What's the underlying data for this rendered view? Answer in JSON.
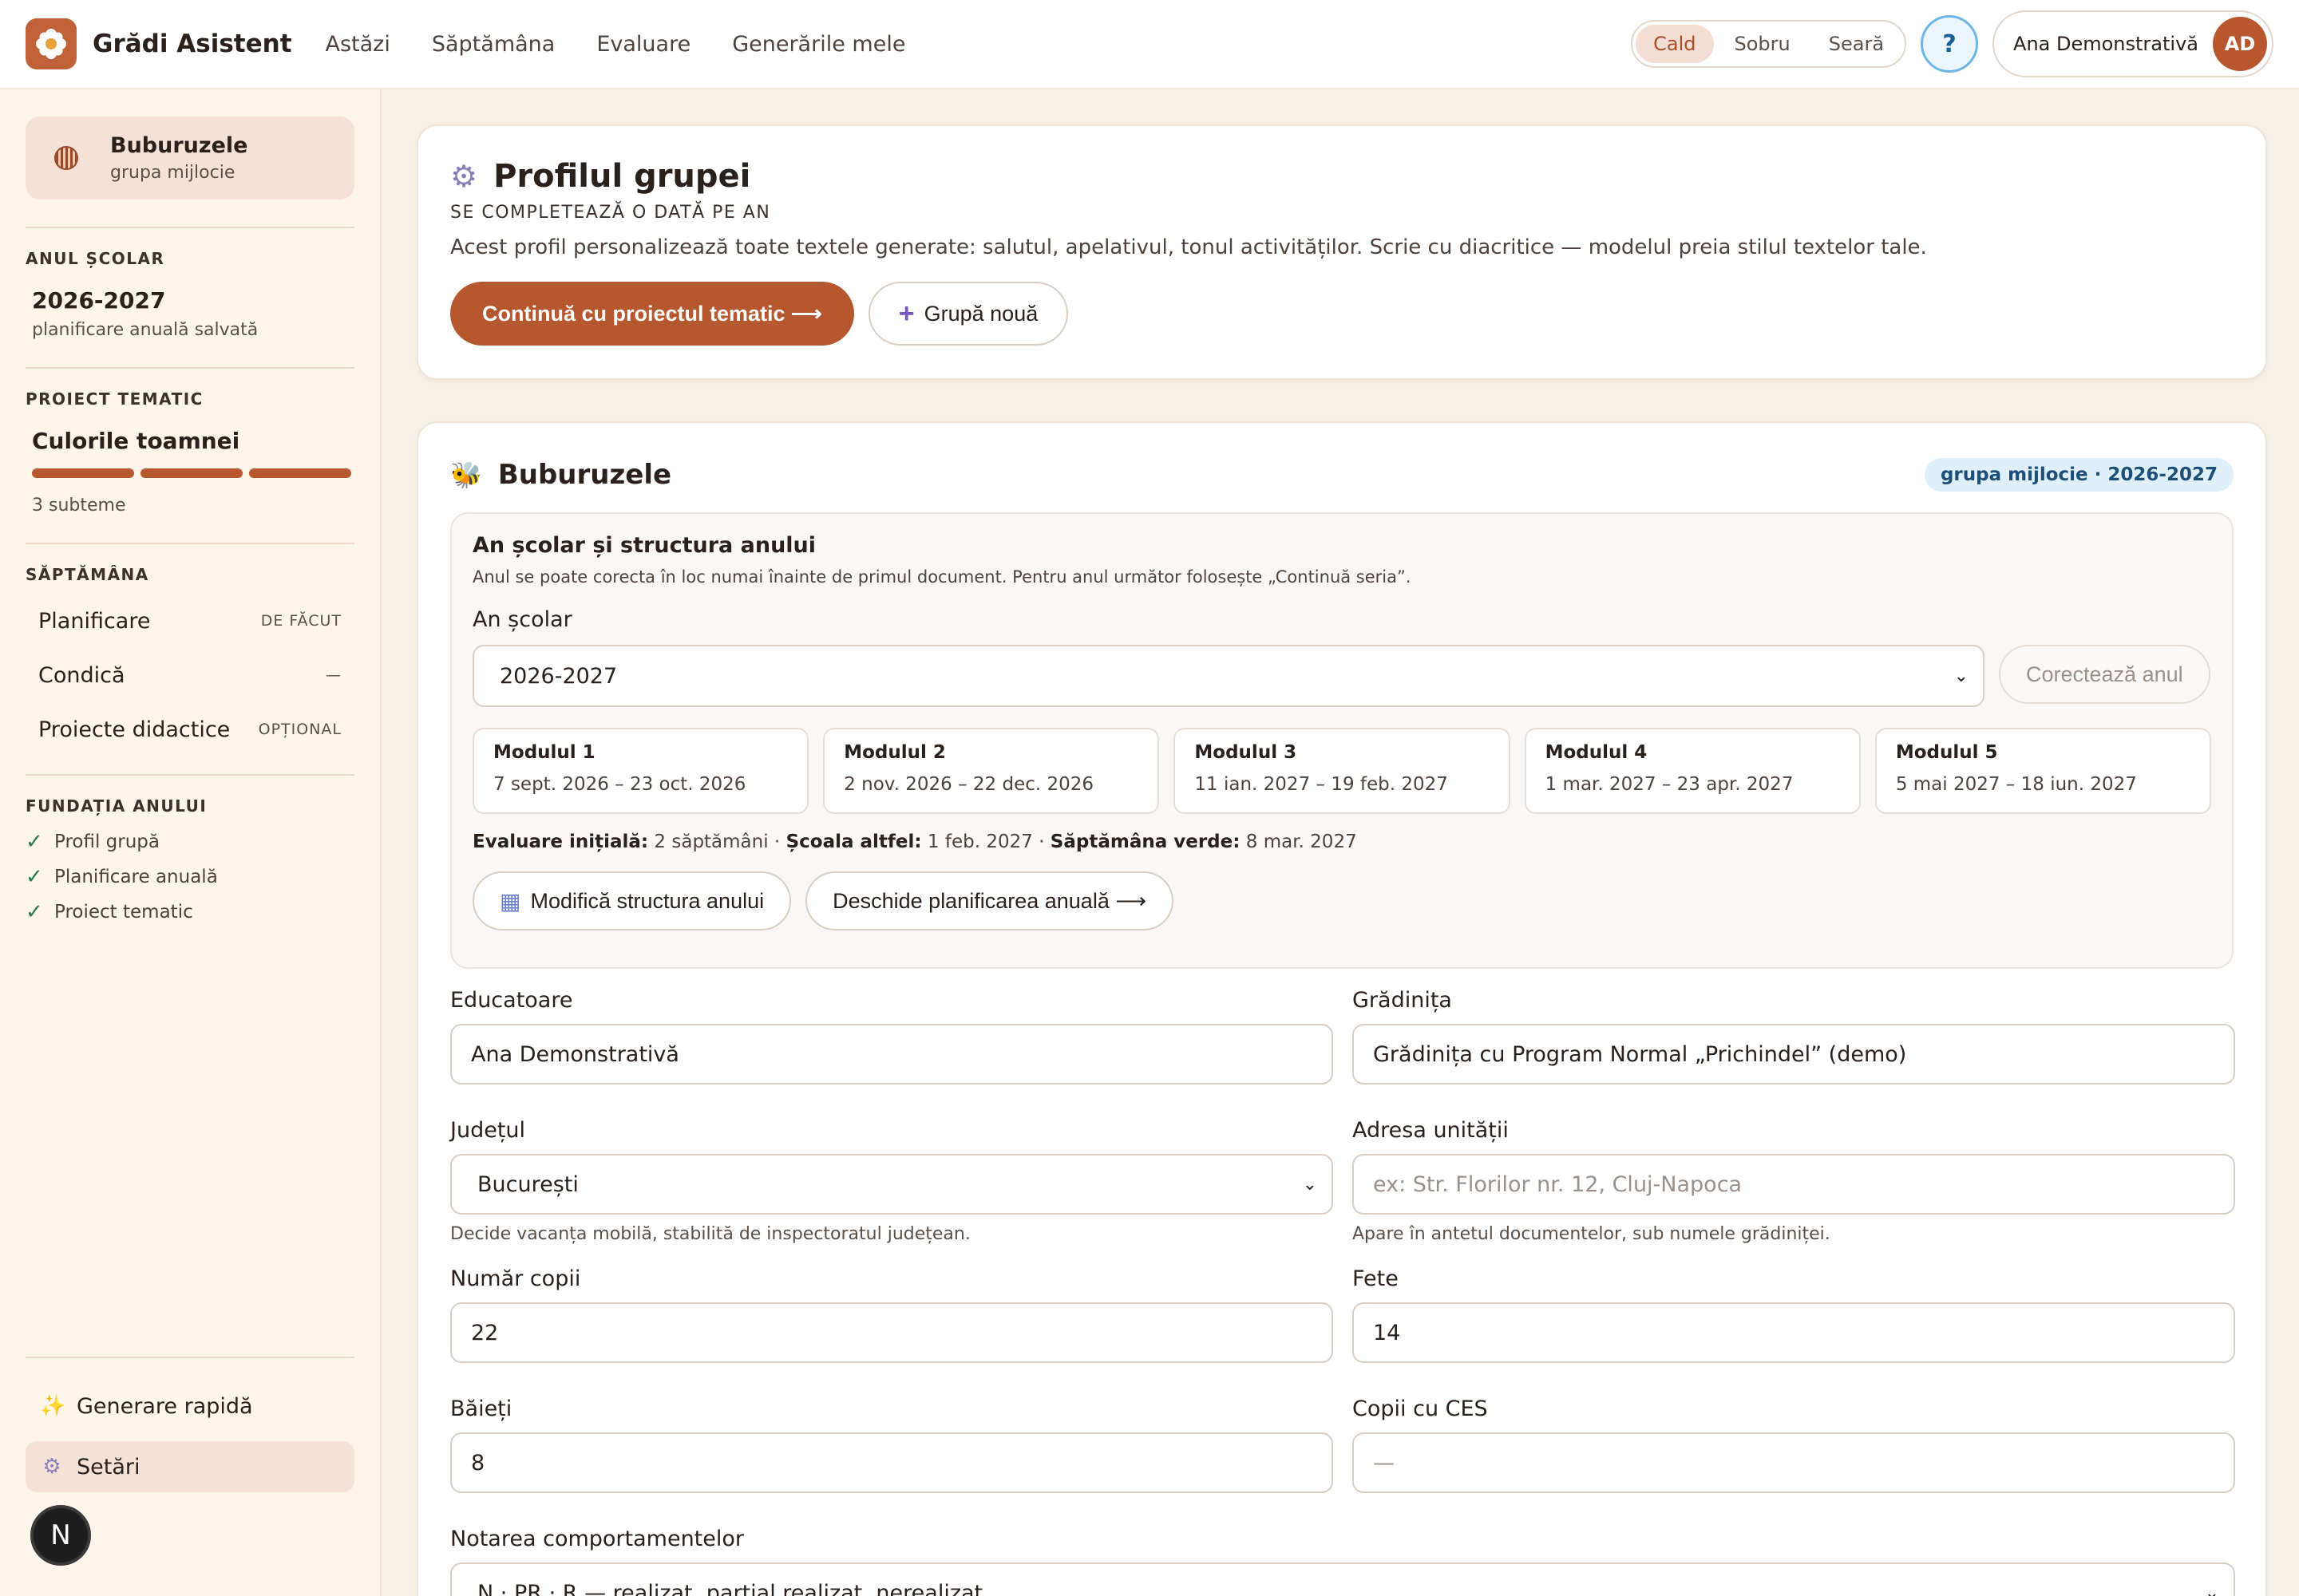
{
  "topbar": {
    "brand": "Grădi Asistent",
    "nav": [
      "Astăzi",
      "Săptămâna",
      "Evaluare",
      "Generările mele"
    ],
    "modes": [
      "Cald",
      "Sobru",
      "Seară"
    ],
    "active_mode": "Cald",
    "help": "?",
    "user_name": "Ana Demonstrativă",
    "user_initials": "AD"
  },
  "sidebar": {
    "group_name": "Buburuzele",
    "group_sub": "grupa mijlocie",
    "year_label": "ANUL ȘCOLAR",
    "year_value": "2026-2027",
    "year_sub": "planificare anuală salvată",
    "project_label": "PROIECT TEMATIC",
    "project_value": "Culorile toamnei",
    "project_sub": "3 subteme",
    "project_progress": [
      1,
      1,
      1
    ],
    "week_label": "SĂPTĂMÂNA",
    "week_items": [
      {
        "label": "Planificare",
        "status": "DE FĂCUT"
      },
      {
        "label": "Condică",
        "status": "—"
      },
      {
        "label": "Proiecte didactice",
        "status": "OPȚIONAL"
      }
    ],
    "foundation_label": "FUNDAȚIA ANULUI",
    "foundation_items": [
      "Profil grupă",
      "Planificare anuală",
      "Proiect tematic"
    ],
    "bottom_links": [
      {
        "label": "Generare rapidă",
        "icon": "sparkles-icon"
      },
      {
        "label": "Setări",
        "icon": "gear-icon"
      }
    ],
    "n_badge": "N"
  },
  "profile_card": {
    "title": "Profilul grupei",
    "eyebrow": "SE COMPLETEAZĂ O DATĂ PE AN",
    "description": "Acest profil personalizează toate textele generate: salutul, apelativul, tonul activităților. Scrie cu diacritice — modelul preia stilul textelor tale.",
    "primary_button": "Continuă cu proiectul tematic ⟶",
    "secondary_button": "Grupă nouă"
  },
  "group_card": {
    "title": "Buburuzele",
    "pill": "grupa mijlocie · 2026-2027",
    "year_panel": {
      "title": "An școlar și structura anului",
      "subtitle": "Anul se poate corecta în loc numai înainte de primul document. Pentru anul următor folosește „Continuă seria”.",
      "label": "An școlar",
      "selected_year": "2026-2027",
      "correct_button": "Corectează anul",
      "modules": [
        {
          "name": "Modulul 1",
          "dates": "7 sept. 2026 – 23 oct. 2026"
        },
        {
          "name": "Modulul 2",
          "dates": "2 nov. 2026 – 22 dec. 2026"
        },
        {
          "name": "Modulul 3",
          "dates": "11 ian. 2027 – 19 feb. 2027"
        },
        {
          "name": "Modulul 4",
          "dates": "1 mar. 2027 – 23 apr. 2027"
        },
        {
          "name": "Modulul 5",
          "dates": "5 mai 2027 – 18 iun. 2027"
        }
      ],
      "meta": [
        {
          "label": "Evaluare inițială:",
          "value": " 2 săptămâni · "
        },
        {
          "label": "Școala altfel:",
          "value": " 1 feb. 2027 · "
        },
        {
          "label": "Săptămâna verde:",
          "value": " 8 mar. 2027"
        }
      ],
      "modify_button": "Modifică structura anului",
      "open_button": "Deschide planificarea anuală ⟶"
    },
    "fields": {
      "educatoare_label": "Educatoare",
      "educatoare_value": "Ana Demonstrativă",
      "gradinita_label": "Grădinița",
      "gradinita_value": "Grădinița cu Program Normal „Prichindel” (demo)",
      "judet_label": "Județul",
      "judet_value": "București",
      "judet_hint": "Decide vacanța mobilă, stabilită de inspectoratul județean.",
      "adresa_label": "Adresa unității",
      "adresa_placeholder": "ex: Str. Florilor nr. 12, Cluj-Napoca",
      "adresa_hint": "Apare în antetul documentelor, sub numele grădiniței.",
      "copii_label": "Număr copii",
      "copii_value": "22",
      "fete_label": "Fete",
      "fete_value": "14",
      "baieti_label": "Băieți",
      "baieti_value": "8",
      "ces_label": "Copii cu CES",
      "ces_placeholder": "—",
      "notare_label": "Notarea comportamentelor",
      "notare_value": "N · PR · R — realizat, parțial realizat, nerealizat"
    }
  },
  "colors": {
    "accent": "#b5582f",
    "page_bg": "#f6f0e8",
    "sidebar_bg": "#fdf4ea",
    "pill_bg": "#dff0fb",
    "check_green": "#2c7a4b"
  }
}
